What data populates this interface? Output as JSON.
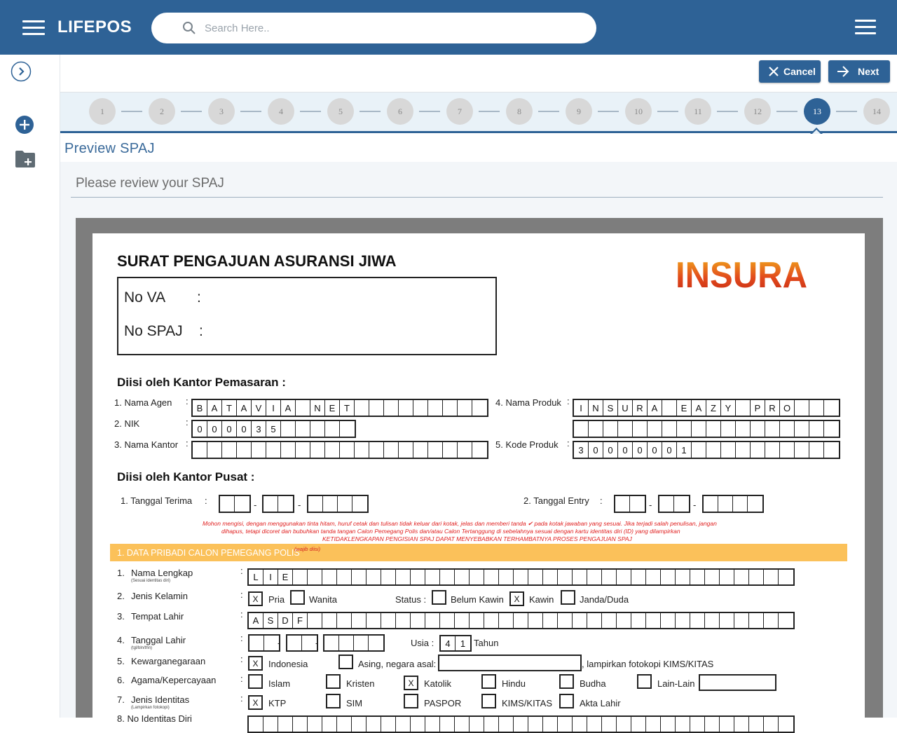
{
  "header": {
    "brand": "LIFEPOS",
    "search_placeholder": "Search Here.."
  },
  "actions": {
    "cancel": "Cancel",
    "next": "Next"
  },
  "stepper": {
    "steps": [
      "1",
      "2",
      "3",
      "4",
      "5",
      "6",
      "7",
      "8",
      "9",
      "10",
      "11",
      "12",
      "13",
      "14"
    ],
    "active": "13"
  },
  "page": {
    "title": "Preview SPAJ",
    "review_text": "Please review your SPAJ"
  },
  "doc": {
    "title": "SURAT PENGAJUAN ASURANSI JIWA",
    "logo_text": "INSURA",
    "no_va_label": "No VA",
    "no_spaj_label": "No SPAJ",
    "colon": ":",
    "marketing_heading": "Diisi oleh Kantor Pemasaran :",
    "agent_label": "1. Nama Agen",
    "nik_label": "2. NIK",
    "office_label": "3. Nama Kantor",
    "product_label": "4. Nama Produk",
    "product_code_label": "5. Kode Produk",
    "agent_chars": [
      "B",
      "A",
      "T",
      "A",
      "V",
      "I",
      "A",
      "",
      "N",
      "E",
      "T",
      "",
      "",
      "",
      "",
      "",
      "",
      "",
      "",
      ""
    ],
    "nik_chars": [
      "0",
      "0",
      "0",
      "0",
      "3",
      "5",
      "",
      "",
      "",
      "",
      ""
    ],
    "office_chars": [
      "",
      "",
      "",
      "",
      "",
      "",
      "",
      "",
      "",
      "",
      "",
      "",
      "",
      "",
      "",
      "",
      "",
      "",
      "",
      ""
    ],
    "product_chars": [
      "I",
      "N",
      "S",
      "U",
      "R",
      "A",
      "",
      "E",
      "A",
      "Z",
      "Y",
      "",
      "P",
      "R",
      "O",
      "",
      "",
      ""
    ],
    "product2_chars": [
      "",
      "",
      "",
      "",
      "",
      "",
      "",
      "",
      "",
      "",
      "",
      "",
      "",
      "",
      "",
      "",
      "",
      ""
    ],
    "code_chars": [
      "3",
      "0",
      "0",
      "0",
      "0",
      "0",
      "0",
      "1",
      "",
      "",
      "",
      "",
      "",
      "",
      "",
      "",
      "",
      ""
    ],
    "central_heading": "Diisi oleh Kantor Pusat :",
    "received_label": "1. Tanggal Terima",
    "entry_label": "2. Tanggal Entry",
    "dash": "-",
    "note1": "Mohon mengisi, dengan menggunakan tinta hitam, huruf cetak dan tulisan tidak keluar dari kotak, jelas dan memberi tanda ✔ pada kotak jawaban yang sesuai. Jika terjadi salah penulisan, jangan",
    "note2": "dihapus, tetapi dicoret dan bubuhkan tanda tangan Calon Pemegang Polis dan/atau Calon Tertanggung di sebelahnya sesuai dengan kartu identitas diri (ID) yang dilampirkan",
    "note3": "KETIDAKLENGKAPAN PENGISIAN SPAJ DAPAT MENYEBABKAN TERHAMBATNYA PROSES PENGAJUAN SPAJ",
    "section1": "1. DATA PRIBADI CALON PEMEGANG POLIS",
    "section1_required": "(wajib diisi)",
    "f1_num": "1.",
    "f1_label": "Nama Lengkap",
    "f1_sub": "(Sesuai identitas diri)",
    "name_chars": [
      "L",
      "I",
      "E",
      "",
      "",
      "",
      "",
      "",
      "",
      "",
      "",
      "",
      "",
      "",
      "",
      "",
      "",
      "",
      "",
      "",
      "",
      "",
      "",
      "",
      "",
      "",
      "",
      "",
      "",
      "",
      "",
      "",
      "",
      "",
      "",
      "",
      ""
    ],
    "f2_num": "2.",
    "f2_label": "Jenis Kelamin",
    "pria": "Pria",
    "wanita": "Wanita",
    "status_label": "Status :",
    "belum_kawin": "Belum Kawin",
    "kawin": "Kawin",
    "janda": "Janda/Duda",
    "f3_num": "3.",
    "f3_label": "Tempat Lahir",
    "birthplace_chars": [
      "A",
      "S",
      "D",
      "F",
      "",
      "",
      "",
      "",
      "",
      "",
      "",
      "",
      "",
      "",
      "",
      "",
      "",
      "",
      "",
      "",
      "",
      "",
      "",
      "",
      "",
      "",
      "",
      "",
      "",
      "",
      "",
      "",
      "",
      "",
      "",
      "",
      ""
    ],
    "f4_num": "4.",
    "f4_label": "Tanggal Lahir",
    "f4_sub": "(tgl/bln/thn)",
    "usia_label": "Usia :",
    "age_chars": [
      "4",
      "1"
    ],
    "tahun": "Tahun",
    "f5_num": "5.",
    "f5_label": "Kewarganegaraan",
    "indonesia": "Indonesia",
    "asing": "Asing, negara asal:",
    "kims_note": ", lampirkan fotokopi KIMS/KITAS",
    "f6_num": "6.",
    "f6_label": "Agama/Kepercayaan",
    "islam": "Islam",
    "kristen": "Kristen",
    "katolik": "Katolik",
    "hindu": "Hindu",
    "budha": "Budha",
    "lain": "Lain-Lain",
    "f7_num": "7.",
    "f7_label": "Jenis Identitas",
    "f7_sub": "(Lampirkan fotokopi)",
    "ktp": "KTP",
    "sim": "SIM",
    "paspor": "PASPOR",
    "kims": "KIMS/KITAS",
    "akta": "Akta Lahir",
    "f8_label": "8. No Identitas Diri",
    "mark": "X"
  },
  "colors": {
    "header_blue": "#2e6296",
    "section_orange": "#fbc15a",
    "note_red": "#e02020"
  }
}
